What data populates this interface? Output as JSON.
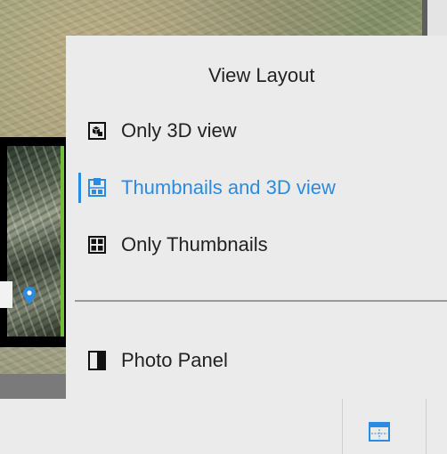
{
  "menu": {
    "title": "View Layout",
    "items": [
      {
        "label": "Only 3D view",
        "icon": "3d-view-icon",
        "active": false
      },
      {
        "label": "Thumbnails and 3D view",
        "icon": "thumbnails-3d-icon",
        "active": true
      },
      {
        "label": "Only Thumbnails",
        "icon": "thumbnails-grid-icon",
        "active": false
      }
    ],
    "secondary_items": [
      {
        "label": "Photo Panel",
        "icon": "photo-panel-icon"
      }
    ]
  },
  "colors": {
    "accent": "#2a8be0",
    "menu_bg": "#ebebeb",
    "text": "#222222"
  },
  "toolbar": {
    "layout_button_icon": "view-layout-icon"
  }
}
